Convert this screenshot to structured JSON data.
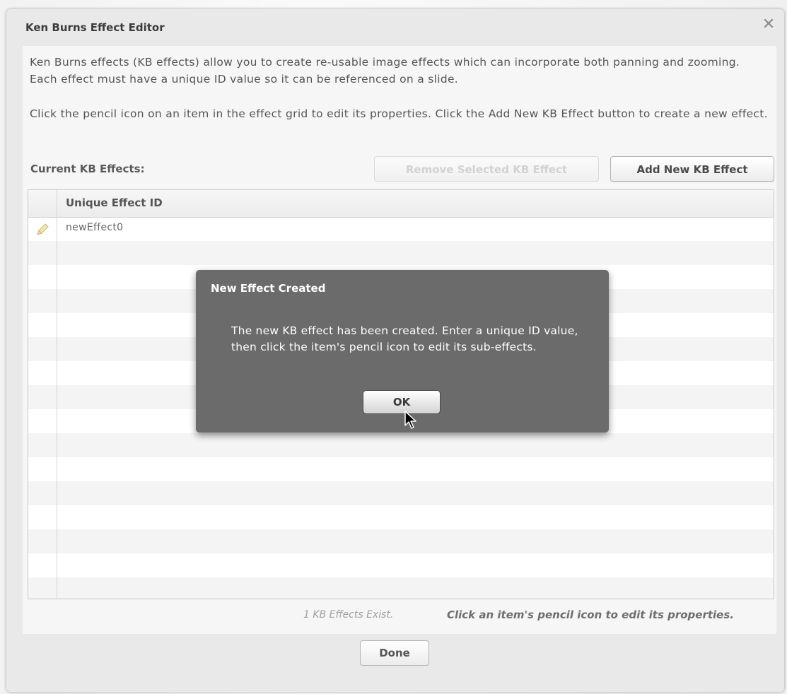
{
  "dialog": {
    "title": "Ken Burns Effect Editor",
    "close_glyph": "✕",
    "description_1": "Ken Burns effects (KB effects) allow you to create re-usable image effects which can incorporate both panning and zooming.  Each effect must have a unique ID value so it can be referenced on a slide.",
    "description_2": "Click the pencil icon on an item in the effect grid to edit its properties.  Click the Add New KB Effect button to create a new effect.",
    "current_label": "Current KB Effects:",
    "remove_button": "Remove Selected KB Effect",
    "add_button": "Add New KB Effect",
    "grid": {
      "column_header": "Unique Effect ID",
      "rows": [
        {
          "id": "newEffect0",
          "icon": "pencil-icon"
        }
      ]
    },
    "status_count": "1 KB Effects Exist.",
    "status_hint": "Click an item's pencil icon to edit its properties.",
    "done_button": "Done"
  },
  "modal": {
    "title": "New Effect Created",
    "message": "The new KB effect has been created.  Enter a unique ID value, then click the item's pencil icon to edit its sub-effects.",
    "ok_button": "OK"
  },
  "colors": {
    "window_bg": "#e9e9e9",
    "content_bg": "#f6f6f6",
    "modal_bg": "#6b6b6b",
    "disabled_text": "#d2d2d2"
  }
}
